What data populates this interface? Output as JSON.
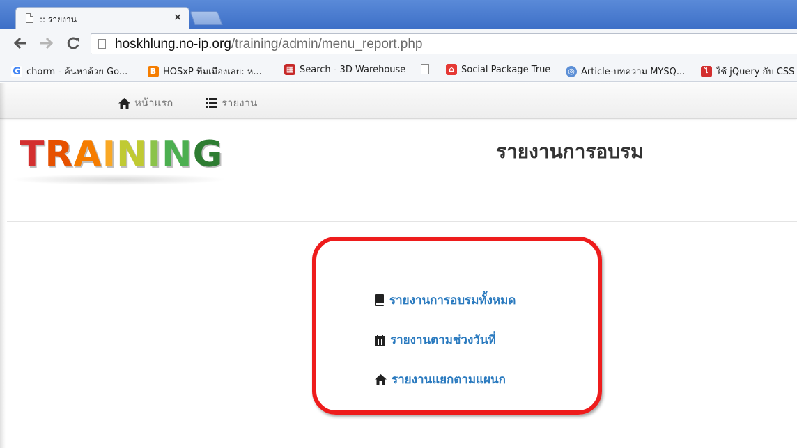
{
  "browser": {
    "tab_title": ":: รายงาน",
    "tab_close": "×",
    "url_host": "hoskhlung.no-ip.org",
    "url_path": "/training/admin/menu_report.php",
    "bookmarks": [
      {
        "label": "chorm - ค้นหาด้วย Go...",
        "icon": "google-icon",
        "color": "#4285f4"
      },
      {
        "label": "HOSxP ทีมเมืองเลย: ห...",
        "icon": "blogger-icon",
        "color": "#f57d00"
      },
      {
        "label": "Search - 3D Warehouse",
        "icon": "warehouse-icon",
        "color": "#c62828"
      },
      {
        "label": "",
        "icon": "page-icon",
        "color": "#ffffff"
      },
      {
        "label": "Social Package True",
        "icon": "true-icon",
        "color": "#e53935"
      },
      {
        "label": "Article-บทความ MYSQ...",
        "icon": "globe-icon",
        "color": "#5c8fd6"
      },
      {
        "label": "ใช้ jQuery กับ CSS",
        "icon": "thai-site-icon",
        "color": "#d32f2f"
      }
    ]
  },
  "site_nav": {
    "home_label": "หน้าแรก",
    "report_label": "รายงาน"
  },
  "logo": {
    "letters": [
      "T",
      "R",
      "A",
      "I",
      "N",
      "I",
      "N",
      "G"
    ],
    "colors": [
      "#d32f2f",
      "#e65100",
      "#f57c00",
      "#f9a825",
      "#c0ca33",
      "#8bc34a",
      "#4caf50",
      "#2e7d32"
    ]
  },
  "page": {
    "title": "รายงานการอบรม"
  },
  "report_links": [
    {
      "label": "รายงานการอบรมทั้งหมด",
      "icon": "book-icon"
    },
    {
      "label": "รายงานตามช่วงวันที่",
      "icon": "calendar-icon"
    },
    {
      "label": "รายงานแยกตามแผนก",
      "icon": "home-icon"
    }
  ],
  "colors": {
    "link": "#2a7abf",
    "highlight": "#ee1c1c"
  }
}
